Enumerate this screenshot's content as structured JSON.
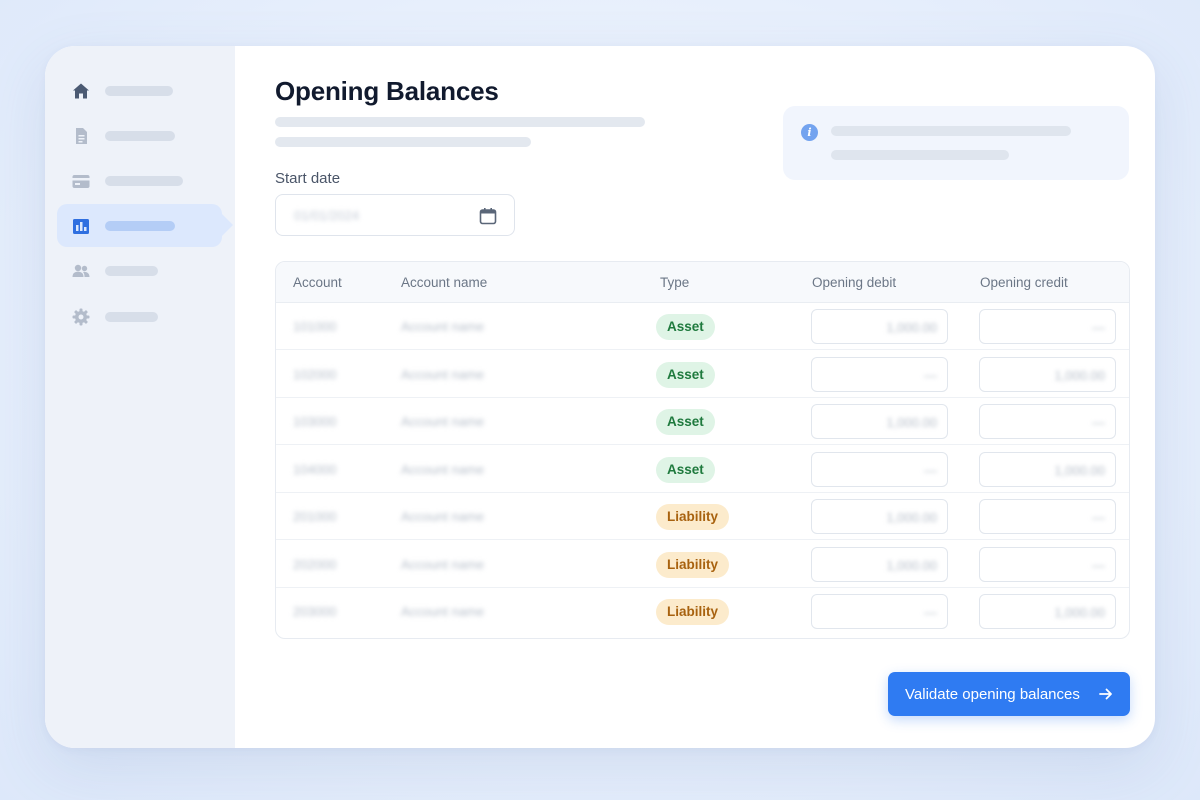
{
  "page": {
    "title": "Opening Balances"
  },
  "sidebar": {
    "items": [
      {
        "icon": "home-icon",
        "active": false
      },
      {
        "icon": "document-icon",
        "active": false
      },
      {
        "icon": "card-icon",
        "active": false
      },
      {
        "icon": "bar-chart-icon",
        "active": true
      },
      {
        "icon": "users-icon",
        "active": false
      },
      {
        "icon": "gear-icon",
        "active": false
      }
    ]
  },
  "info": {
    "icon": "info-icon"
  },
  "start_date": {
    "label": "Start date",
    "value": "01/01/2024",
    "icon": "calendar-icon"
  },
  "table": {
    "columns": [
      "Account",
      "Account name",
      "Type",
      "Opening debit",
      "Opening credit"
    ],
    "rows": [
      {
        "account": "101000",
        "name": "Account name",
        "type": "Asset",
        "debit": "1,000.00",
        "credit": "—"
      },
      {
        "account": "102000",
        "name": "Account name",
        "type": "Asset",
        "debit": "—",
        "credit": "1,000.00"
      },
      {
        "account": "103000",
        "name": "Account name",
        "type": "Asset",
        "debit": "1,000.00",
        "credit": "—"
      },
      {
        "account": "104000",
        "name": "Account name",
        "type": "Asset",
        "debit": "—",
        "credit": "1,000.00"
      },
      {
        "account": "201000",
        "name": "Account name",
        "type": "Liability",
        "debit": "1,000.00",
        "credit": "—"
      },
      {
        "account": "202000",
        "name": "Account name",
        "type": "Liability",
        "debit": "1,000.00",
        "credit": "—"
      },
      {
        "account": "203000",
        "name": "Account name",
        "type": "Liability",
        "debit": "—",
        "credit": "1,000.00"
      }
    ]
  },
  "actions": {
    "validate_label": "Validate opening balances",
    "validate_icon": "arrow-right-icon"
  },
  "colors": {
    "primary": "#2f7bf2",
    "asset_bg": "#dff4e6",
    "asset_text": "#1f7a3e",
    "liability_bg": "#fcebcc",
    "liability_text": "#a8620f"
  }
}
